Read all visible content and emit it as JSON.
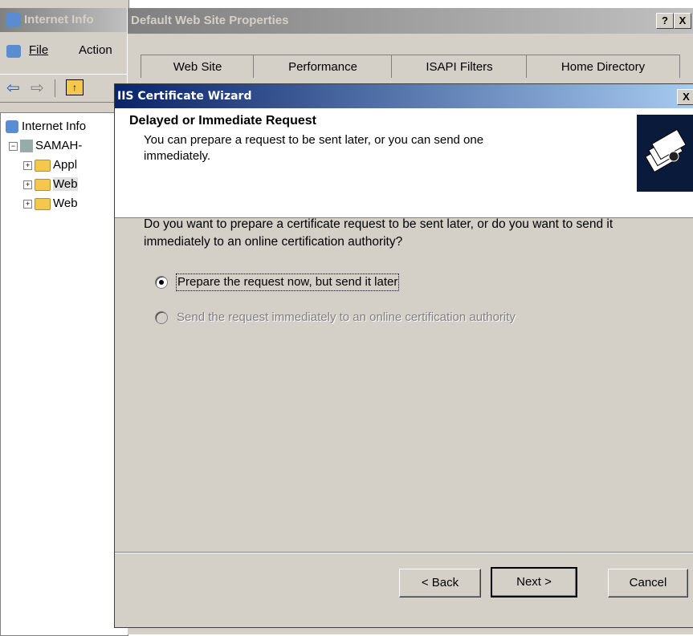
{
  "bg_window": {
    "title": "Internet Info",
    "menu": [
      "File",
      "Action"
    ],
    "tree": [
      "Internet Info",
      "SAMAH-",
      "Appl",
      "Web",
      "Web"
    ]
  },
  "props_window": {
    "title": "Default Web Site Properties",
    "help_btn": "?",
    "close_btn": "X",
    "tabs": [
      "Web Site",
      "Performance",
      "ISAPI Filters",
      "Home Directory"
    ]
  },
  "wizard": {
    "title": "IIS Certificate Wizard",
    "close_btn": "X",
    "header_title": "Delayed or Immediate Request",
    "header_desc": "You can prepare a request to be sent later, or you can send one immediately.",
    "question": "Do you want to prepare a certificate request to be sent later, or do you want to send it immediately to an online certification authority?",
    "options": [
      {
        "label": "Prepare the request now, but send it later",
        "selected": true,
        "enabled": true
      },
      {
        "label": "Send the request immediately to an online certification authority",
        "selected": false,
        "enabled": false
      }
    ],
    "buttons": {
      "back": "< Back",
      "next": "Next >",
      "cancel": "Cancel"
    }
  },
  "colors": {
    "dialog_bg": "#d4d0c8",
    "active_title_start": "#0a246a",
    "active_title_end": "#a6caf0",
    "disabled_text": "#808080"
  }
}
